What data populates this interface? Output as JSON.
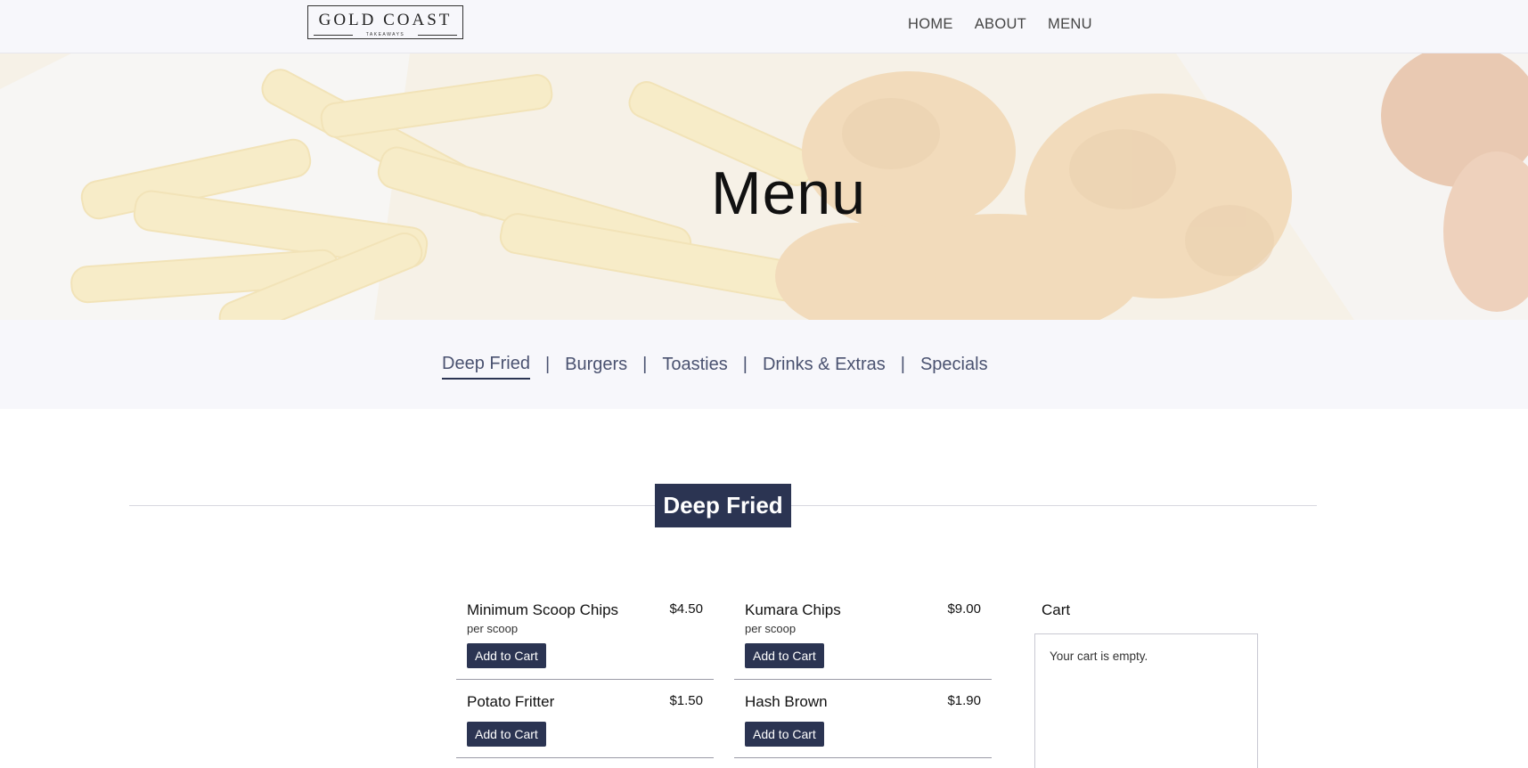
{
  "header": {
    "logo": {
      "main": "GOLD COAST",
      "sub": "TAKEAWAYS"
    },
    "nav": [
      "HOME",
      "ABOUT",
      "MENU"
    ]
  },
  "hero": {
    "title": "Menu"
  },
  "categories": {
    "items": [
      "Deep Fried",
      "Burgers",
      "Toasties",
      "Drinks & Extras",
      "Specials"
    ],
    "active": "Deep Fried",
    "separator": "|"
  },
  "section": {
    "title": "Deep Fried"
  },
  "items": [
    {
      "name": "Minimum Scoop Chips",
      "price": "$4.50",
      "note": "per scoop",
      "button": "Add to Cart"
    },
    {
      "name": "Kumara Chips",
      "price": "$9.00",
      "note": "per scoop",
      "button": "Add to Cart"
    },
    {
      "name": "Potato Fritter",
      "price": "$1.50",
      "note": "",
      "button": "Add to Cart"
    },
    {
      "name": "Hash Brown",
      "price": "$1.90",
      "note": "",
      "button": "Add to Cart"
    }
  ],
  "cart": {
    "title": "Cart",
    "empty_text": "Your cart is empty."
  },
  "colors": {
    "accent": "#2b3452",
    "nav_text": "#444444",
    "category_text": "#4a5270",
    "bar_background": "#f7f7fb"
  }
}
